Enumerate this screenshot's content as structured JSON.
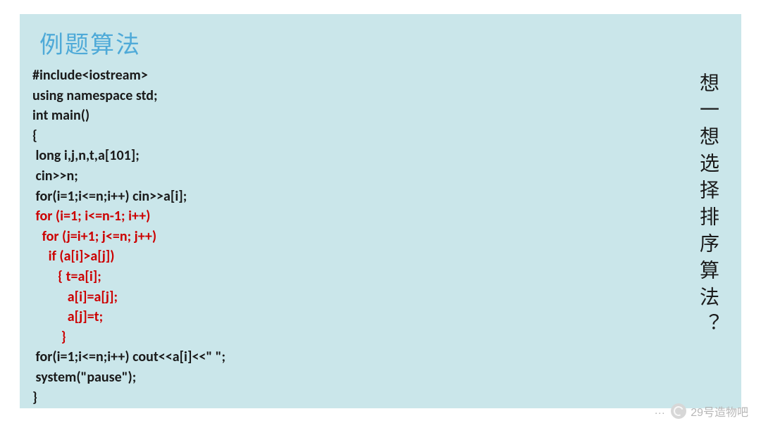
{
  "title": "例题算法",
  "code": {
    "l1": "#include<iostream>",
    "l2": "using namespace std;",
    "l3": "int main()",
    "l4": "{",
    "l5": " long i,j,n,t,a[101];",
    "l6": " cin>>n;",
    "l7": " for(i=1;i<=n;i++) cin>>a[i];",
    "l8": " for (i=1; i<=n-1; i++)",
    "l9": "   for (j=i+1; j<=n; j++)",
    "l10": "     if (a[i]>a[j])",
    "l11": "        { t=a[i];",
    "l12": "           a[i]=a[j];",
    "l13": "           a[j]=t;",
    "l14": "         }",
    "l15": " for(i=1;i<=n;i++) cout<<a[i]<<\" \";",
    "l16": " system(\"pause\");",
    "l17": "}"
  },
  "vertical_question": "想一想选择排序算法？",
  "watermark": {
    "dots": "…",
    "text": "29号造物吧"
  }
}
